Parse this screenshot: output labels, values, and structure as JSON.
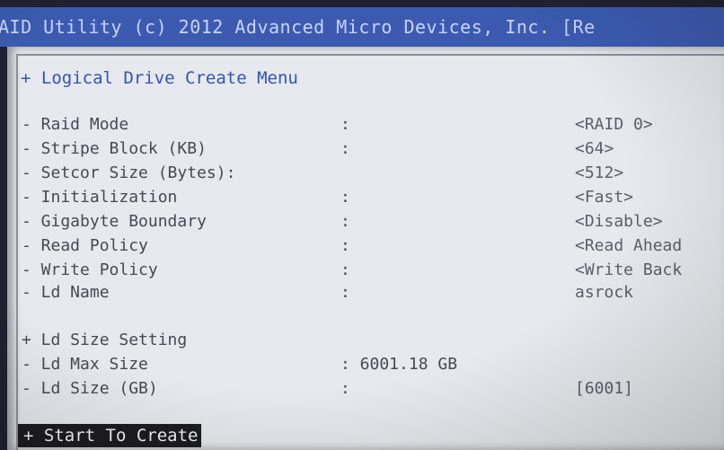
{
  "title_bar": {
    "text": "AID Utility (c) 2012 Advanced Micro Devices, Inc. [Re"
  },
  "menu": {
    "title": "+ Logical Drive Create Menu",
    "items": [
      {
        "label": "- Raid Mode",
        "colon": ":",
        "value": "<RAID 0>"
      },
      {
        "label": "- Stripe Block (KB)",
        "colon": ":",
        "value": "<64>"
      },
      {
        "label": "- Setcor Size  (Bytes):",
        "colon": "",
        "value": "<512>"
      },
      {
        "label": "- Initialization",
        "colon": ":",
        "value": "<Fast>"
      },
      {
        "label": "- Gigabyte Boundary",
        "colon": ":",
        "value": "<Disable>"
      },
      {
        "label": "- Read Policy",
        "colon": ":",
        "value": "<Read Ahead"
      },
      {
        "label": "- Write Policy",
        "colon": ":",
        "value": "<Write Back"
      },
      {
        "label": "- Ld Name",
        "colon": ":",
        "value": "asrock"
      }
    ]
  },
  "size_section": {
    "title": "+ Ld Size Setting",
    "max_size_label": "- Ld Max Size",
    "max_size_value": ": 6001.18 GB",
    "size_label": "- Ld Size (GB)",
    "size_colon": ":",
    "size_value": "[6001]"
  },
  "start_button": {
    "label": "+ Start To Create"
  }
}
